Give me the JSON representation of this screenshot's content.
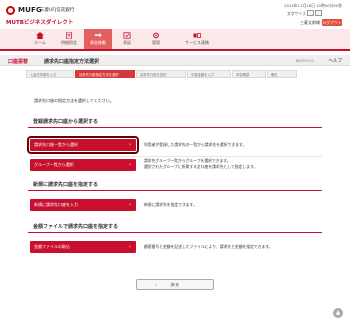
{
  "header": {
    "logo": "MUFG",
    "bank_name": "三菱UFJ信託銀行",
    "service_name": "MUTBビジネスダイレクト",
    "datetime": "2014年11月16日 10時00分00秒",
    "font_size_label": "文字サイズ",
    "font_size_small": "小",
    "font_size_medium": "中",
    "user_name": "三菱太郎様",
    "logout_label": "ログアウト"
  },
  "nav": {
    "items": [
      {
        "label": "ホーム",
        "icon": "home-icon"
      },
      {
        "label": "明細照会",
        "icon": "document-icon"
      },
      {
        "label": "資金移動",
        "icon": "transfer-icon"
      },
      {
        "label": "承認",
        "icon": "approve-icon"
      },
      {
        "label": "管理",
        "icon": "admin-icon"
      },
      {
        "label": "サービス連携",
        "icon": "service-icon"
      }
    ],
    "active_index": 2
  },
  "title_bar": {
    "section": "口座振替",
    "title": "請求先口座指定方法選択",
    "screen_id": "BKSP0101",
    "help": "ヘルプ"
  },
  "steps": [
    "入金先情報を入力",
    "請求先口座指定方法を選択",
    "請求先口座を選択",
    "引落金額を入力",
    "内容確認",
    "確定"
  ],
  "active_step": 1,
  "lead": "請求先口座の指定方法を選択してください。",
  "sections": [
    {
      "heading": "登録請求先口座から選択する",
      "rows": [
        {
          "button": "請求先口座一覧から選択",
          "desc": [
            "利用者が登録した請求先の一覧から請求先を選択できます。"
          ]
        },
        {
          "button": "グループ一覧から選択",
          "desc": [
            "請求先グループ一覧からグループを選択できます。",
            "選択されたグループに所属する全口座を請求先として指定します。"
          ]
        }
      ]
    },
    {
      "heading": "新規に請求先口座を指定する",
      "rows": [
        {
          "button": "新規に請求先口座を入力",
          "desc": [
            "新規に請求先を指定できます。"
          ]
        }
      ]
    },
    {
      "heading": "金額ファイルで請求先口座を指定する",
      "rows": [
        {
          "button": "金額ファイルの取込",
          "desc": [
            "顧客番号と金額を記述したファイルにより、請求先と金額を指定できます。"
          ]
        }
      ]
    }
  ],
  "back_label": "戻る",
  "page_top": "▲",
  "colors": {
    "accent": "#c8102e",
    "nav_active": "#e46060"
  }
}
